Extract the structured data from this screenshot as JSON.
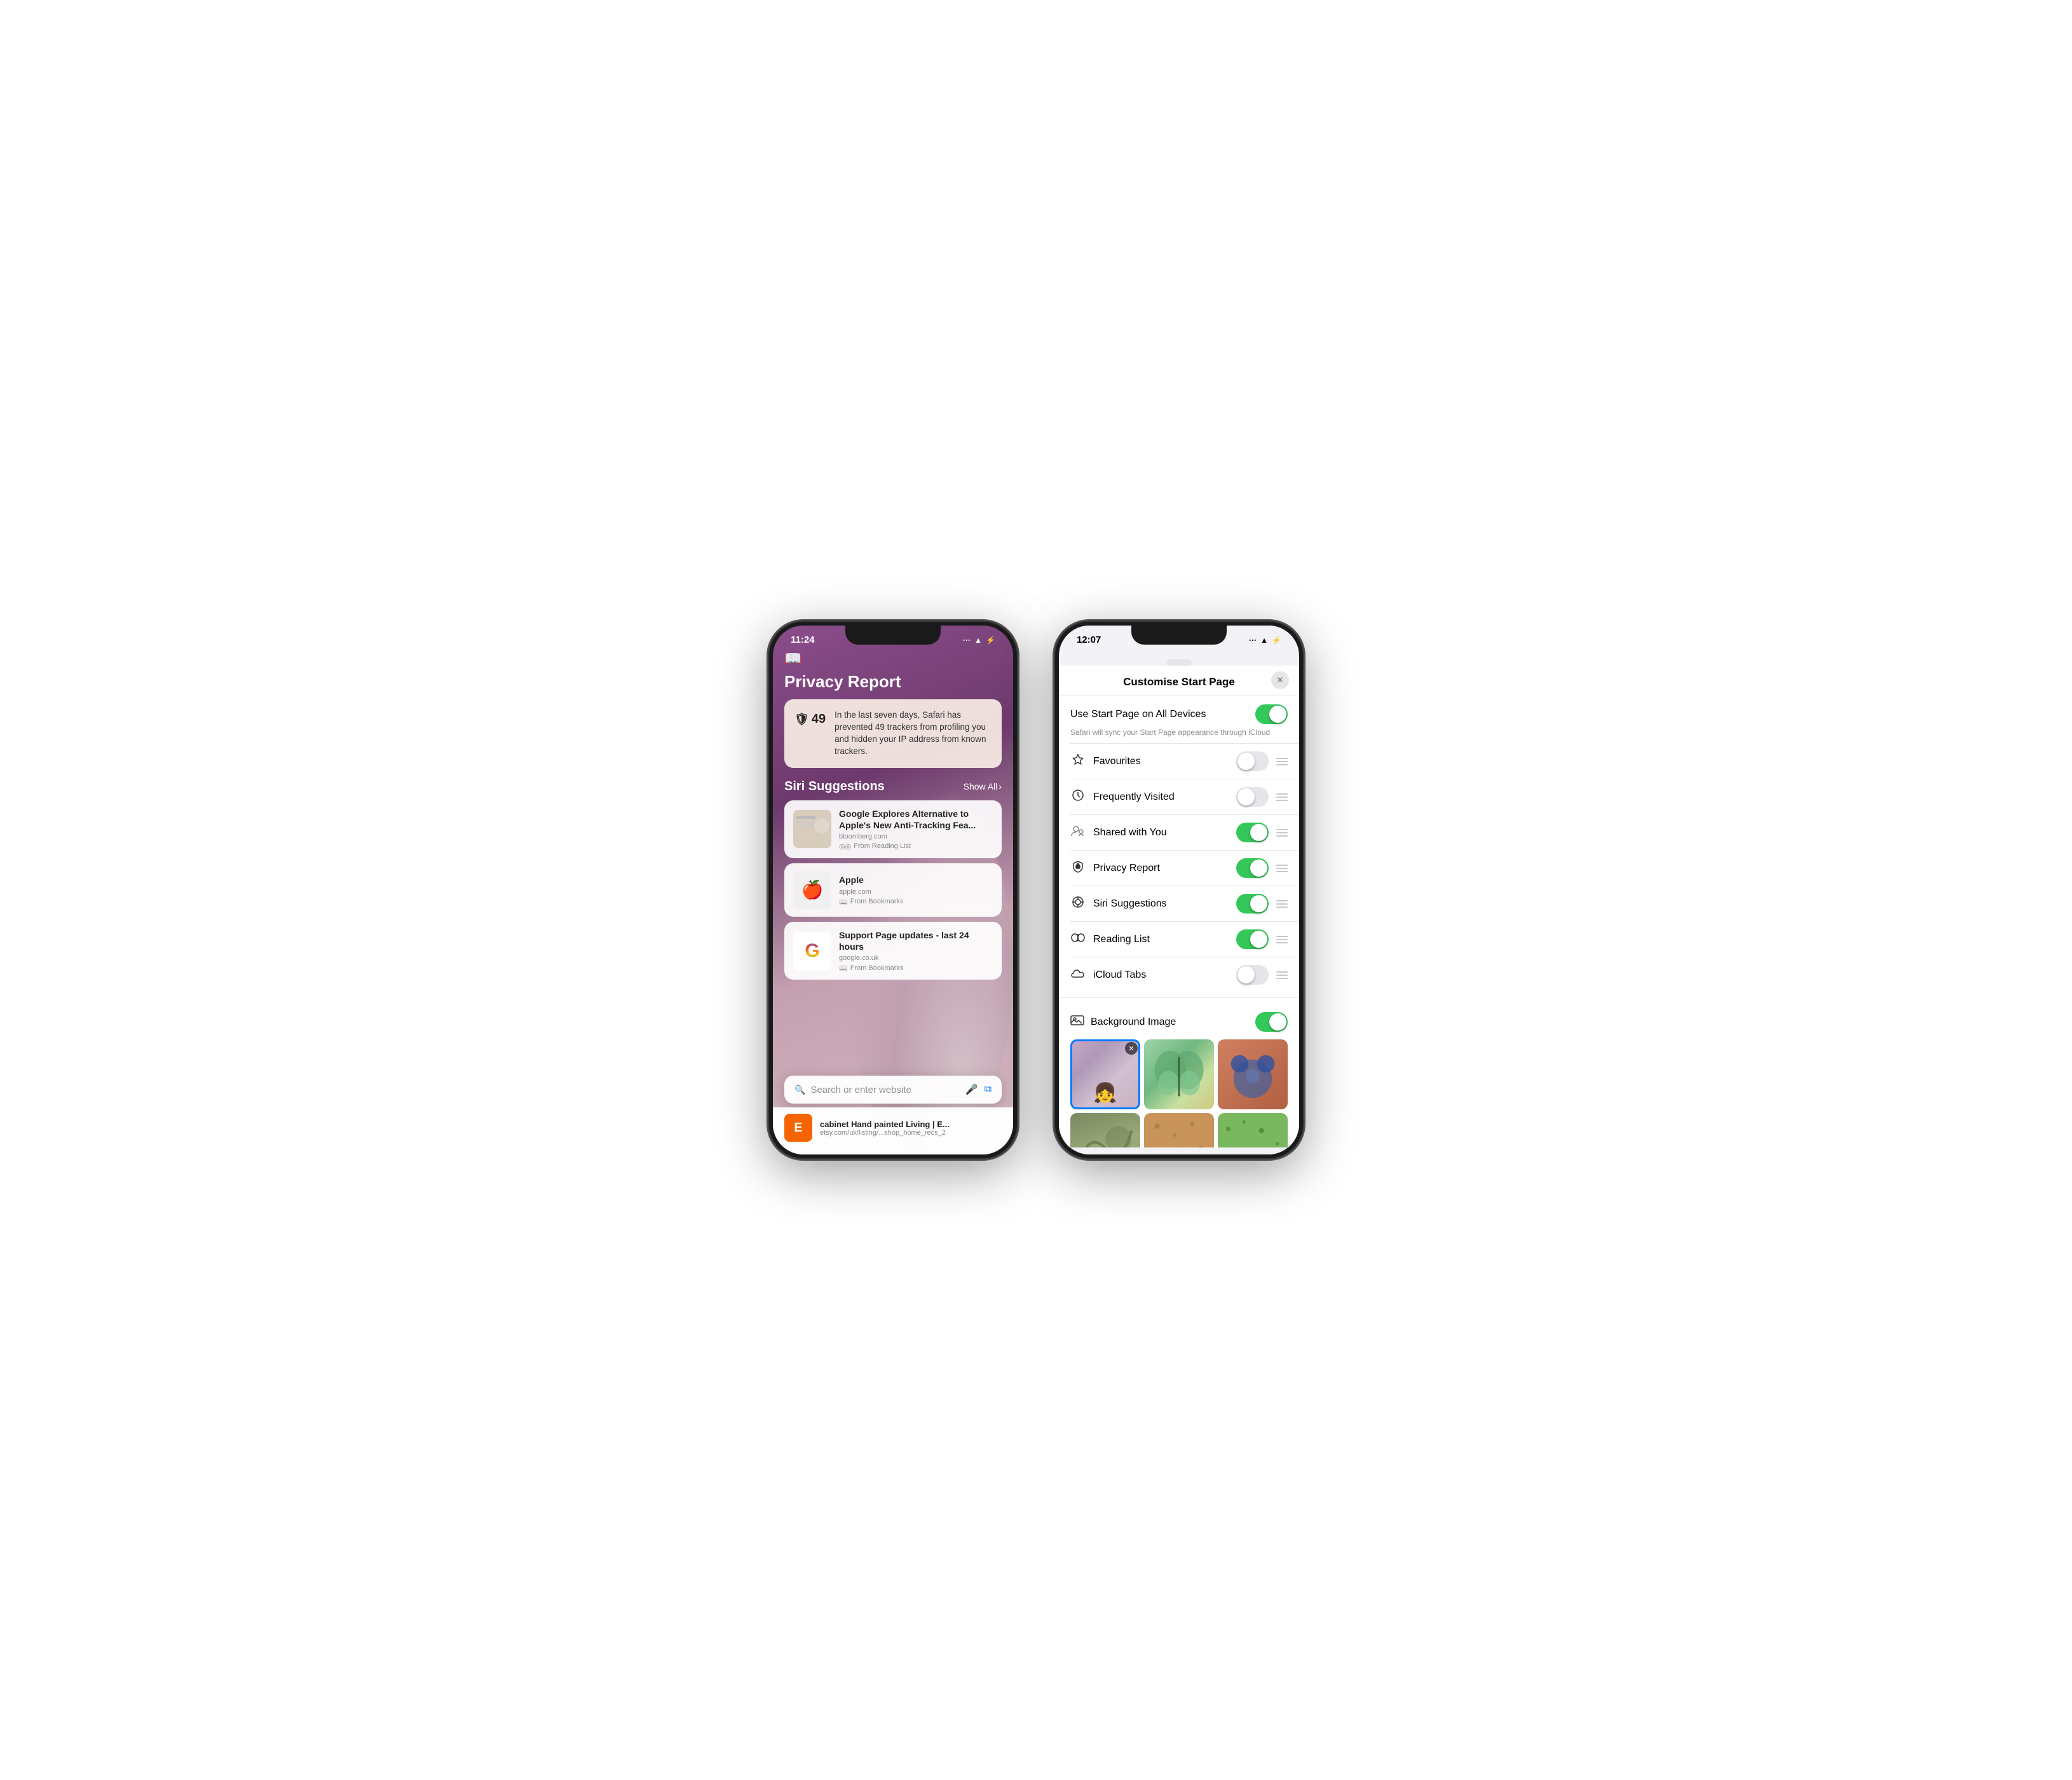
{
  "phone1": {
    "status": {
      "time": "11:24",
      "signal": "···",
      "wifi": "WiFi",
      "battery": "charging"
    },
    "privacy": {
      "title": "Privacy Report",
      "trackerCount": "49",
      "description": "In the last seven days, Safari has prevented 49 trackers from profiling you and hidden your IP address from known trackers."
    },
    "siri": {
      "title": "Siri Suggestions",
      "showAll": "Show All"
    },
    "suggestions": [
      {
        "title": "Google Explores Alternative to Apple's New Anti-Tracking Fea...",
        "url": "bloomberg.com",
        "source": "From Reading List",
        "thumbType": "news"
      },
      {
        "title": "Apple",
        "url": "apple.com",
        "source": "From Bookmarks",
        "thumbType": "apple"
      },
      {
        "title": "Support Page updates - last 24 hours",
        "url": "google.co.uk",
        "source": "From Bookmarks",
        "thumbType": "google"
      }
    ],
    "search": {
      "placeholder": "Search or enter website"
    },
    "etsy": {
      "title": "cabinet Hand painted Living | E...",
      "url": "etsy.com/uk/listing/...shop_home_recs_2",
      "logo": "E"
    }
  },
  "phone2": {
    "status": {
      "time": "12:07",
      "signal": "···",
      "wifi": "WiFi",
      "battery": "charging"
    },
    "sheet": {
      "title": "Customise Start Page",
      "closeLabel": "✕"
    },
    "mainToggle": {
      "label": "Use Start Page on All Devices",
      "on": true,
      "subText": "Safari will sync your Start Page appearance through iCloud"
    },
    "items": [
      {
        "icon": "★",
        "label": "Favourites",
        "on": false,
        "iconType": "star"
      },
      {
        "icon": "🕐",
        "label": "Frequently Visited",
        "on": false,
        "iconType": "clock"
      },
      {
        "icon": "👤",
        "label": "Shared with You",
        "on": true,
        "iconType": "person"
      },
      {
        "icon": "🛡",
        "label": "Privacy Report",
        "on": true,
        "iconType": "shield"
      },
      {
        "icon": "◎",
        "label": "Siri Suggestions",
        "on": true,
        "iconType": "siri"
      },
      {
        "icon": "◎◎",
        "label": "Reading List",
        "on": true,
        "iconType": "readinglist"
      },
      {
        "icon": "☁",
        "label": "iCloud Tabs",
        "on": false,
        "iconType": "cloud"
      }
    ],
    "background": {
      "label": "Background Image",
      "on": true,
      "swatches": [
        "child",
        "green",
        "orange",
        "olive",
        "sand",
        "lime"
      ]
    }
  }
}
